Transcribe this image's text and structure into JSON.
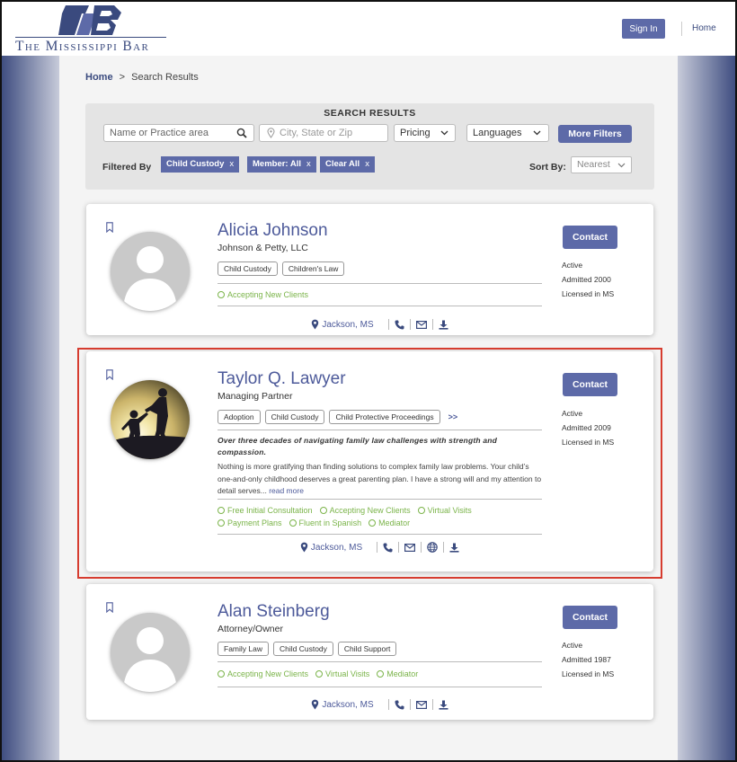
{
  "header": {
    "logo_letters": "MB",
    "logo_text": "The Mississippi Bar",
    "signin_label": "Sign In",
    "home_label": "Home"
  },
  "breadcrumb": {
    "home": "Home",
    "separator": ">",
    "current": "Search Results"
  },
  "search": {
    "title": "SEARCH RESULTS",
    "name_placeholder": "Name or Practice area",
    "location_placeholder": "City, State or Zip",
    "pricing_label": "Pricing",
    "languages_label": "Languages",
    "more_filters_label": "More Filters",
    "filtered_by_label": "Filtered By",
    "chips": [
      {
        "label": "Child Custody",
        "x": "x"
      },
      {
        "label": "Member: All",
        "x": "x"
      },
      {
        "label": "Clear All",
        "x": "x"
      }
    ],
    "sort_label": "Sort By:",
    "sort_value": "Nearest"
  },
  "results": [
    {
      "name": "Alicia Johnson",
      "firm": "Johnson & Petty, LLC",
      "tags": [
        "Child Custody",
        "Children's Law"
      ],
      "features": [
        "Accepting New Clients"
      ],
      "location": "Jackson, MS",
      "contact_label": "Contact",
      "status": [
        "Active",
        "Admitted 2000",
        "Licensed in MS"
      ]
    },
    {
      "name": "Taylor Q. Lawyer",
      "firm": "Managing Partner",
      "tags": [
        "Adoption",
        "Child Custody",
        "Child Protective Proceedings"
      ],
      "more": ">>",
      "tagline": "Over three decades of navigating family law challenges with strength and compassion.",
      "bio": "Nothing is more gratifying than finding solutions to complex family law problems. Your child’s one-and-only childhood deserves a great parenting plan. I have a strong will and my attention to detail serves...",
      "read_more": "read more",
      "features": [
        "Free Initial Consultation",
        "Accepting New Clients",
        "Virtual Visits",
        "Payment Plans",
        "Fluent in Spanish",
        "Mediator"
      ],
      "location": "Jackson, MS",
      "contact_label": "Contact",
      "status": [
        "Active",
        "Admitted 2009",
        "Licensed in MS"
      ]
    },
    {
      "name": "Alan Steinberg",
      "firm": "Attorney/Owner",
      "tags": [
        "Family Law",
        "Child Custody",
        "Child Support"
      ],
      "features": [
        "Accepting New Clients",
        "Virtual Visits",
        "Mediator"
      ],
      "location": "Jackson, MS",
      "contact_label": "Contact",
      "status": [
        "Active",
        "Admitted 1987",
        "Licensed in MS"
      ]
    }
  ],
  "colors": {
    "brand": "#3a4a7e",
    "button": "#5d6aa8",
    "feature_green": "#7bb44a",
    "highlight_red": "#d63c2f"
  },
  "icons": [
    "bookmark-icon",
    "search-icon",
    "location-pin-icon",
    "chevron-down-icon",
    "phone-icon",
    "mail-icon",
    "globe-icon",
    "download-icon",
    "check-circle-icon"
  ]
}
